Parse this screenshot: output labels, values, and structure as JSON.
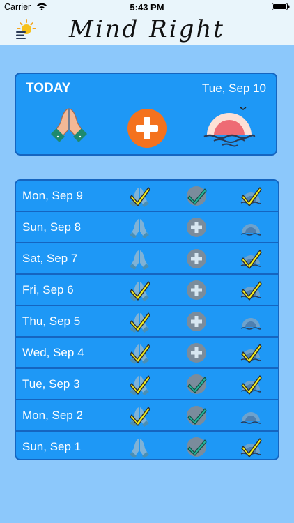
{
  "status_bar": {
    "carrier": "Carrier",
    "time": "5:43 PM"
  },
  "nav": {
    "title": "Mind Right",
    "menu_icon": "sun-menu-icon"
  },
  "today": {
    "label": "TODAY",
    "date": "Tue, Sep 10",
    "icons": [
      "praying-hands-icon",
      "add-icon",
      "sunrise-icon"
    ]
  },
  "colors": {
    "row": "#1e98f6",
    "divider": "#1565c0",
    "background": "#8cc8fb",
    "check": "#f5ef1c",
    "add_orange": "#f4721e"
  },
  "history": [
    {
      "date": "Mon, Sep 9",
      "prayer": "done",
      "action": "done",
      "sunrise": "done"
    },
    {
      "date": "Sun, Sep 8",
      "prayer": "none",
      "action": "add",
      "sunrise": "none"
    },
    {
      "date": "Sat, Sep 7",
      "prayer": "none",
      "action": "add",
      "sunrise": "done"
    },
    {
      "date": "Fri, Sep 6",
      "prayer": "done",
      "action": "add",
      "sunrise": "done"
    },
    {
      "date": "Thu, Sep 5",
      "prayer": "done",
      "action": "add",
      "sunrise": "none"
    },
    {
      "date": "Wed, Sep 4",
      "prayer": "done",
      "action": "add",
      "sunrise": "done"
    },
    {
      "date": "Tue, Sep 3",
      "prayer": "done",
      "action": "done",
      "sunrise": "done"
    },
    {
      "date": "Mon, Sep 2",
      "prayer": "done",
      "action": "done",
      "sunrise": "none"
    },
    {
      "date": "Sun, Sep 1",
      "prayer": "none",
      "action": "done",
      "sunrise": "done"
    }
  ]
}
